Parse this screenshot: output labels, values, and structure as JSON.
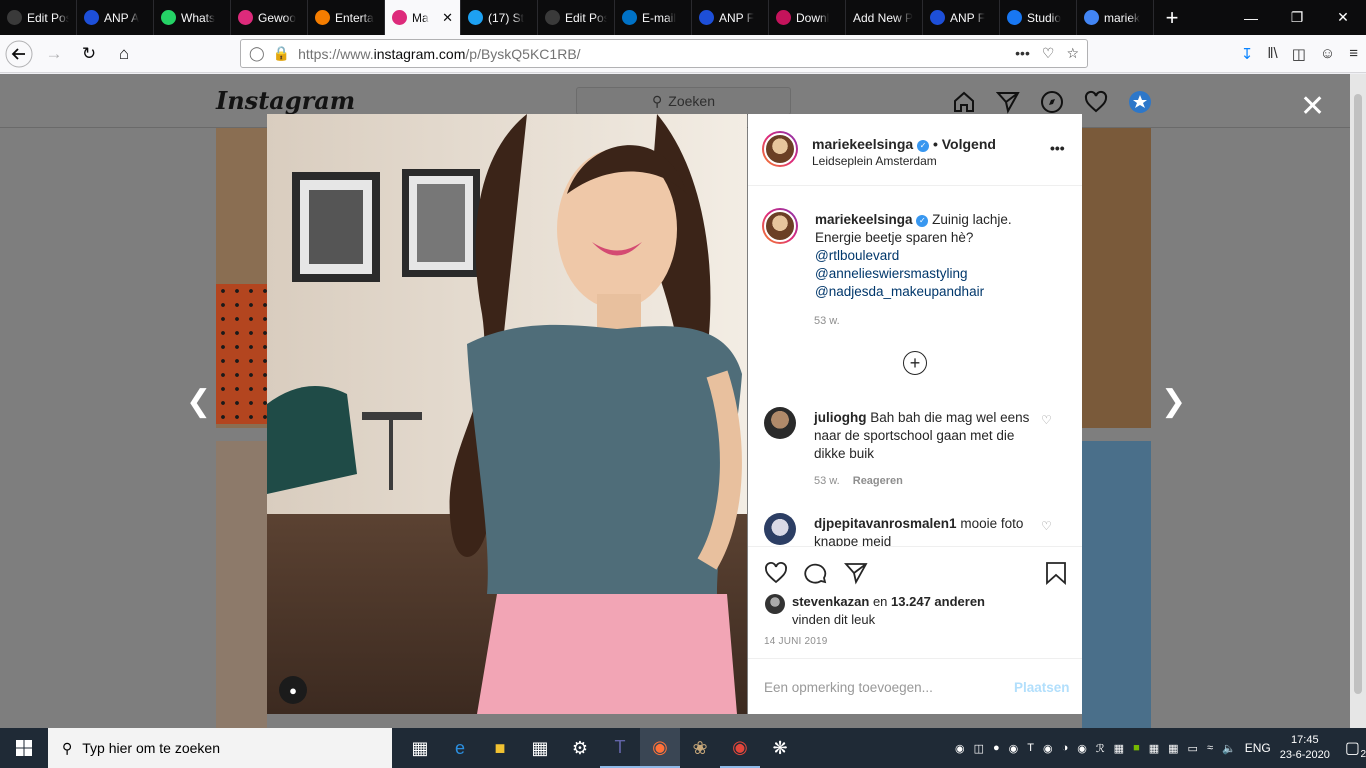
{
  "browser": {
    "tabs": [
      {
        "label": "Edit Post ‹",
        "icon": "wordpress-icon",
        "color": ""
      },
      {
        "label": "ANP A",
        "icon": "anp-icon",
        "color": "#1d4fd8"
      },
      {
        "label": "Whats",
        "icon": "whatsapp-icon",
        "color": "#25d366"
      },
      {
        "label": "Gewoo",
        "icon": "instagram-icon",
        "color": "#dd2a7b"
      },
      {
        "label": "Enterta",
        "icon": "blogger-icon",
        "color": "#f57d00"
      },
      {
        "label": "Ma",
        "icon": "instagram-icon",
        "color": "#dd2a7b",
        "active": true
      },
      {
        "label": "(17) St",
        "icon": "twitter-icon",
        "color": "#1da1f2"
      },
      {
        "label": "Edit Post ‹",
        "icon": "wordpress-icon",
        "color": ""
      },
      {
        "label": "E-mail",
        "icon": "outlook-icon",
        "color": "#0072c6"
      },
      {
        "label": "ANP F",
        "icon": "anp-icon",
        "color": "#1d4fd8"
      },
      {
        "label": "Downl",
        "icon": "download-icon",
        "color": "#c4135b"
      },
      {
        "label": "Add New P",
        "icon": "none",
        "color": ""
      },
      {
        "label": "ANP F",
        "icon": "anp-icon",
        "color": "#1d4fd8"
      },
      {
        "label": "Studio",
        "icon": "facebook-icon",
        "color": "#1877f2"
      },
      {
        "label": "mariek",
        "icon": "google-icon",
        "color": "#4285f4"
      }
    ],
    "url_prefix": "https://www.",
    "url_domain": "instagram.com",
    "url_path": "/p/ByskQ5KC1RB/"
  },
  "instagram": {
    "logo": "Instagram",
    "search_placeholder": "Zoeken",
    "post": {
      "username": "mariekeelsinga",
      "follow_status": "• Volgend",
      "location": "Leidseplein Amsterdam",
      "caption_text": "Zuinig lachje.",
      "caption_line2": "Energie beetje sparen hè?",
      "mentions": [
        "@rtlboulevard",
        "@annelieswiersmastyling",
        "@nadjesda_makeupandhair"
      ],
      "caption_age": "53 w.",
      "comments": [
        {
          "user": "julioghg",
          "text": "Bah bah die mag wel eens naar de sportschool gaan met die dikke buik",
          "age": "53 w.",
          "reply": "Reageren"
        },
        {
          "user": "djpepitavanrosmalen1",
          "text": "mooie foto knappe meid"
        }
      ],
      "likes_user": "stevenkazan",
      "likes_middle": "en",
      "likes_count": "13.247 anderen",
      "likes_suffix": "vinden dit leuk",
      "date": "14 JUNI 2019",
      "comment_placeholder": "Een opmerking toevoegen...",
      "post_button": "Plaatsen"
    }
  },
  "taskbar": {
    "search_placeholder": "Typ hier om te zoeken",
    "language": "ENG",
    "time": "17:45",
    "date": "23-6-2020",
    "notifications": "2"
  }
}
